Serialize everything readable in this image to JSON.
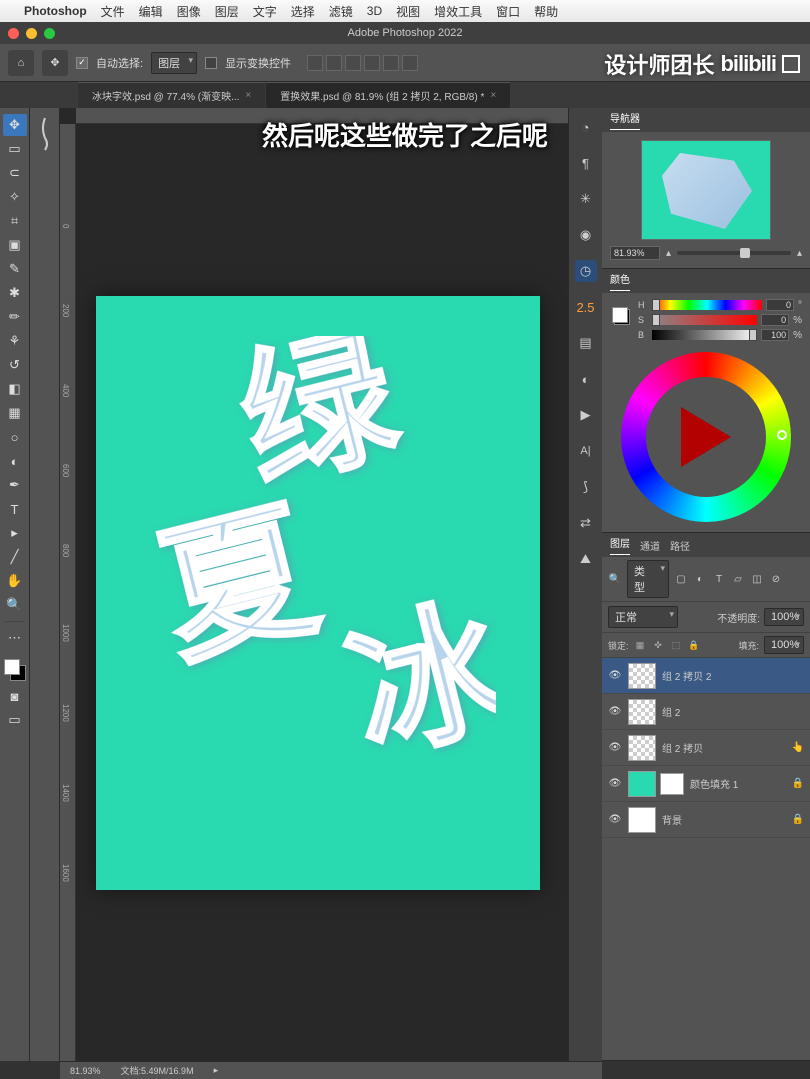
{
  "menubar": {
    "app": "Photoshop",
    "items": [
      "文件",
      "编辑",
      "图像",
      "图层",
      "文字",
      "选择",
      "滤镜",
      "3D",
      "视图",
      "增效工具",
      "窗口",
      "帮助"
    ]
  },
  "titlebar": "Adobe Photoshop 2022",
  "optbar": {
    "auto_select": "自动选择:",
    "auto_select_mode": "图层",
    "show_transform": "显示变换控件"
  },
  "tabs": [
    {
      "label": "冰块字效.psd @ 77.4% (渐变映...",
      "active": false
    },
    {
      "label": "置换效果.psd @ 81.9% (组 2 拷贝 2, RGB/8) *",
      "active": true
    }
  ],
  "navigator": {
    "title": "导航器",
    "zoom": "81.93%"
  },
  "color_panel": {
    "title": "颜色",
    "h": "0",
    "s": "0",
    "b": "100"
  },
  "brush_size": "2.5",
  "layers_panel": {
    "tabs": [
      "图层",
      "通道",
      "路径"
    ],
    "filter_label": "类型",
    "blend": "正常",
    "opacity_label": "不透明度:",
    "opacity": "100%",
    "lock_label": "锁定:",
    "fill_label": "填充:",
    "fill": "100%",
    "layers": [
      {
        "name": "组 2 拷贝 2",
        "sel": true,
        "thumb": "checker"
      },
      {
        "name": "组 2",
        "thumb": "checker"
      },
      {
        "name": "组 2 拷贝",
        "thumb": "checker"
      },
      {
        "name": "颜色填充 1",
        "thumb": "teal",
        "mask": true,
        "lock": true
      },
      {
        "name": "背景",
        "thumb": "white",
        "lock": true
      }
    ]
  },
  "status": {
    "zoom": "81.93%",
    "doc": "文档:5.49M/16.9M"
  },
  "ruler_marks": [
    "0",
    "200",
    "400",
    "600",
    "800",
    "1000",
    "1200",
    "1400",
    "1600"
  ],
  "watermark": "设计师团长",
  "subtitle": "然后呢这些做完了之后呢",
  "search_placeholder": "Q 类型"
}
